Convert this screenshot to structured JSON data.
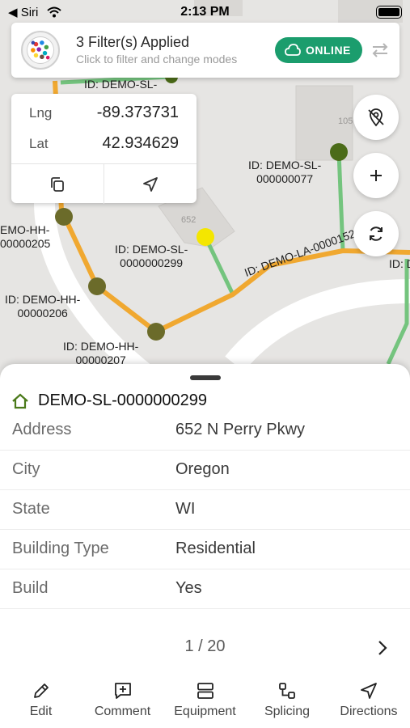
{
  "status_bar": {
    "back_label": "◀ Siri",
    "time": "2:13 PM"
  },
  "filter_bar": {
    "title": "3 Filter(s) Applied",
    "subtitle": "Click to filter and change modes",
    "online_label": "ONLINE"
  },
  "coordinates": {
    "lng_label": "Lng",
    "lng_value": "-89.373731",
    "lat_label": "Lat",
    "lat_value": "42.934629"
  },
  "map": {
    "labels": [
      "ID: DEMO-SL-",
      "ID: DEMO-SL-\n000000077",
      "EMO-HH-\n00000205",
      "ID: DEMO-SL-\n0000000299",
      "ID: DEMO-HH-\n00000206",
      "ID: DEMO-HH-\n00000207",
      "ID: DEMO-LA-0000152",
      "ID: D",
      "652",
      "105"
    ]
  },
  "sheet": {
    "title": "DEMO-SL-0000000299",
    "attributes": [
      {
        "label": "Address",
        "value": "652 N Perry Pkwy"
      },
      {
        "label": "City",
        "value": "Oregon"
      },
      {
        "label": "State",
        "value": "WI"
      },
      {
        "label": "Building Type",
        "value": "Residential"
      },
      {
        "label": "Build",
        "value": "Yes"
      }
    ],
    "pager": "1 / 20"
  },
  "toolbar": [
    {
      "label": "Edit",
      "icon": "pencil-icon"
    },
    {
      "label": "Comment",
      "icon": "comment-plus-icon"
    },
    {
      "label": "Equipment",
      "icon": "server-icon"
    },
    {
      "label": "Splicing",
      "icon": "splice-icon"
    },
    {
      "label": "Directions",
      "icon": "navigation-arrow-icon"
    }
  ],
  "colors": {
    "online": "#1b9d6d",
    "cable_orange": "#f0a830",
    "drop_green": "#74c47e",
    "node_dark": "#4b6b18",
    "selected_node": "#f4e600",
    "home_icon": "#4b7a1a"
  }
}
